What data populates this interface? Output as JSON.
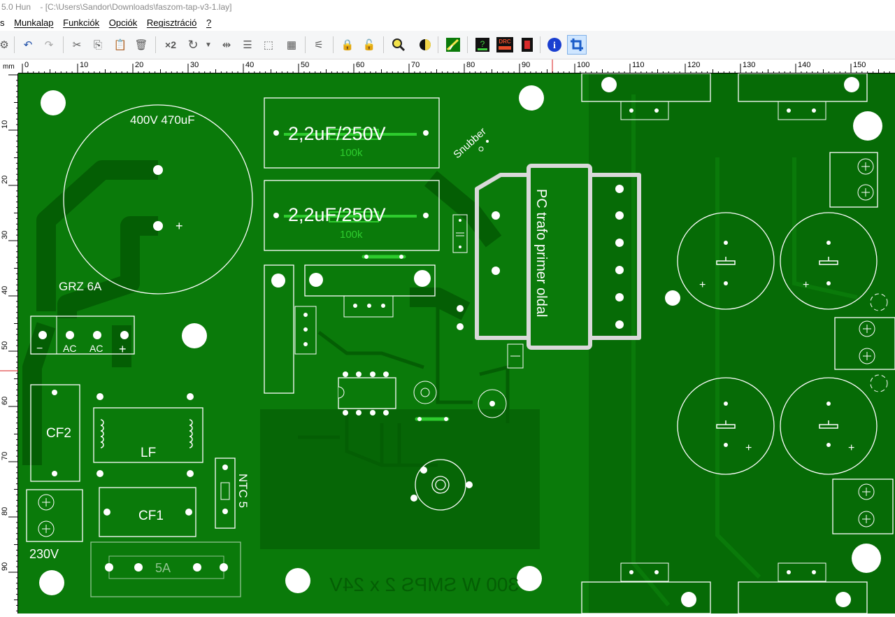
{
  "window": {
    "title_left": "5.0 Hun",
    "title_path": "- [C:\\Users\\Sandor\\Downloads\\faszom-tap-v3-1.lay]"
  },
  "menu": {
    "items": [
      "s",
      "Munkalap",
      "Funkciók",
      "Opciók",
      "Regisztráció",
      "?"
    ]
  },
  "toolbar": {
    "buttons": [
      "gear-icon",
      "undo-icon",
      "redo-icon",
      "cut-icon",
      "copy-icon",
      "paste-icon",
      "delete-icon",
      "duplicate-icon",
      "rotate-icon",
      "dropdown-icon",
      "mirror-icon",
      "align-icon",
      "group-icon",
      "grid-icon",
      "macro-icon",
      "lock-icon",
      "unlock-icon",
      "zoom-icon",
      "mask-icon",
      "autoroute-icon",
      "test-icon",
      "drc-icon",
      "macro-library-icon",
      "info-icon",
      "crop-icon"
    ],
    "duplicate_label": "×2",
    "drc_label": "DRC"
  },
  "ruler": {
    "unit": "mm",
    "top_labels": [
      "0",
      "10",
      "20",
      "30",
      "40",
      "50",
      "60",
      "70",
      "80",
      "90",
      "100",
      "110",
      "120",
      "130",
      "140",
      "150"
    ],
    "left_labels": [
      "10",
      "20",
      "30",
      "40",
      "50",
      "60",
      "70",
      "80",
      "90"
    ]
  },
  "pcb": {
    "colors": {
      "board": "#0a7a0a",
      "copper": "#045e04",
      "silk": "#ffffff",
      "pad": "#ffffff",
      "accent": "#2ecc2e"
    },
    "silk_labels": {
      "cap_main": "400V 470uF",
      "cap_x1": "2,2uF/250V",
      "cap_x2": "2,2uF/250V",
      "res1": "100k",
      "res2": "100k",
      "snubber": "Snubber",
      "trafo": "PC trafo primer oldal",
      "grz": "GRZ 6A",
      "term_minus": "−",
      "term_ac1": "AC",
      "term_ac2": "AC",
      "term_plus": "+",
      "cf2": "CF2",
      "lf": "LF",
      "cf1": "CF1",
      "ntc": "NTC 5",
      "v230": "230V",
      "fuse": "5A",
      "board_text": "300 W SMPS 2 x 24V"
    }
  }
}
